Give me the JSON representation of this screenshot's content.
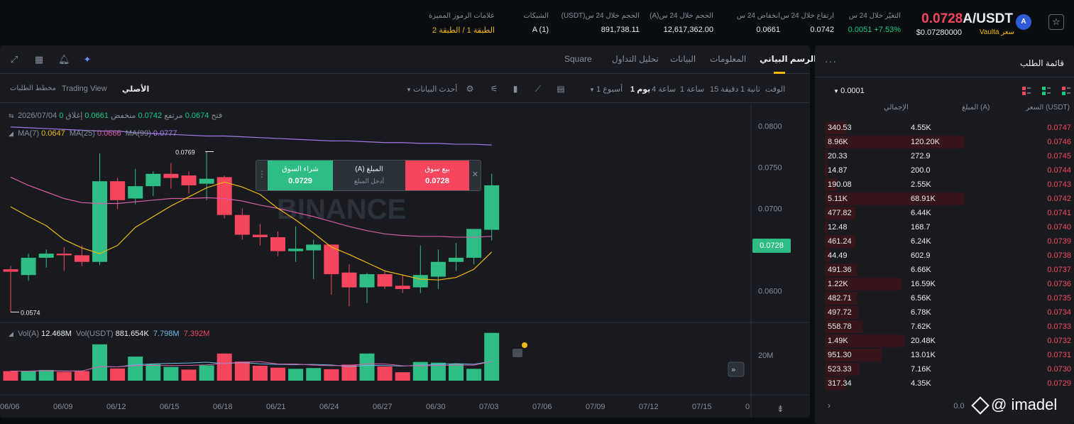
{
  "header": {
    "pair": "A/USDT",
    "last_price": "0.0728",
    "vault_label": "سعر Vaulta",
    "vault_price": "$0.07280000",
    "stats": [
      {
        "label": "التغيّر خلال 24 س",
        "value": "0.0051 +7.53%",
        "tone": "green"
      },
      {
        "label": "ارتفاع خلال 24 س",
        "value": "0.0742",
        "tone": "white"
      },
      {
        "label": "انخفاض 24 س",
        "value": "0.0661",
        "tone": "white"
      },
      {
        "label": "الحجم خلال 24 س(A)",
        "value": "12,617,362.00",
        "tone": "white"
      },
      {
        "label": "الحجم خلال 24 س(USDT)",
        "value": "891,738.11",
        "tone": "white"
      },
      {
        "label": "الشبكات",
        "value": "A (1)",
        "tone": "white"
      },
      {
        "label": "علامات الرموز المميزة",
        "value": "الطبقة 1 / الطبقة 2",
        "tone": "yellow"
      }
    ]
  },
  "chart_tabs": {
    "items": [
      "الرسم البياني",
      "المعلومات",
      "البيانات",
      "تحليل التداول",
      "Square"
    ],
    "active": 0
  },
  "toolbar": {
    "views": [
      "الأصلي",
      "Trading View",
      "مخطط الطلبات"
    ],
    "intervals": [
      "الوقت",
      "1 ثانية",
      "15 دقيقة",
      "1 ساعة",
      "4 ساعة",
      "1 يوم",
      "1 أسبوع"
    ],
    "active_interval": "1 يوم",
    "latest_data": "أحدث البيانات"
  },
  "ohlc": {
    "date": "2026/07/04",
    "open_label": "فتح",
    "open": "0.0674",
    "high_label": "مرتفع",
    "high": "0.0742",
    "low_label": "منخفض",
    "low": "0.0661",
    "close_label": "إغلاق",
    "close": "0"
  },
  "ma": {
    "ma7_label": "MA(7)",
    "ma7": "0.0647",
    "ma25_label": "MA(25)",
    "ma25": "0.0666",
    "ma99_label": "MA(99)",
    "ma99": "0.0777"
  },
  "volume": {
    "label": "Vol(A)",
    "vol_a": "12.468M",
    "usdt_label": "Vol(USDT)",
    "vol_usdt": "881.654K",
    "ma1": "7.798M",
    "ma2": "7.392M"
  },
  "trade_box": {
    "buy_label": "شراء السوق",
    "buy_price": "0.0729",
    "amount_label": "المبلغ (A)",
    "amount_placeholder": "أدخل المبلغ",
    "sell_label": "بيع سوق",
    "sell_price": "0.0728"
  },
  "chart_data": {
    "type": "candlestick",
    "price_ticks": [
      "0.0800",
      "0.0750",
      "0.0700",
      "0.0650",
      "0.0600"
    ],
    "volume_ticks": [
      "20M"
    ],
    "x_ticks": [
      "06/06",
      "06/09",
      "06/12",
      "06/15",
      "06/18",
      "06/21",
      "06/24",
      "06/27",
      "06/30",
      "07/03",
      "07/06",
      "07/09",
      "07/12",
      "07/15",
      "0"
    ],
    "ylim": [
      0.057,
      0.081
    ],
    "current_price": "0.0728",
    "annotations": {
      "max": "0.0769",
      "min": "0.0574"
    },
    "candles": [
      {
        "o": 0.0626,
        "h": 0.063,
        "l": 0.0574,
        "c": 0.0623
      },
      {
        "o": 0.0619,
        "h": 0.0645,
        "l": 0.0612,
        "c": 0.064
      },
      {
        "o": 0.064,
        "h": 0.065,
        "l": 0.0628,
        "c": 0.0645
      },
      {
        "o": 0.0645,
        "h": 0.0653,
        "l": 0.0624,
        "c": 0.0643
      },
      {
        "o": 0.0643,
        "h": 0.0655,
        "l": 0.063,
        "c": 0.0635
      },
      {
        "o": 0.0635,
        "h": 0.0767,
        "l": 0.0631,
        "c": 0.0733
      },
      {
        "o": 0.0733,
        "h": 0.0737,
        "l": 0.0699,
        "c": 0.071
      },
      {
        "o": 0.0712,
        "h": 0.0748,
        "l": 0.0705,
        "c": 0.0727
      },
      {
        "o": 0.0727,
        "h": 0.0745,
        "l": 0.0715,
        "c": 0.0742
      },
      {
        "o": 0.0742,
        "h": 0.0755,
        "l": 0.0724,
        "c": 0.0737
      },
      {
        "o": 0.074,
        "h": 0.0745,
        "l": 0.0718,
        "c": 0.0728
      },
      {
        "o": 0.073,
        "h": 0.0769,
        "l": 0.071,
        "c": 0.0736
      },
      {
        "o": 0.0738,
        "h": 0.074,
        "l": 0.0688,
        "c": 0.0692
      },
      {
        "o": 0.0692,
        "h": 0.07,
        "l": 0.0662,
        "c": 0.0668
      },
      {
        "o": 0.0668,
        "h": 0.0681,
        "l": 0.0655,
        "c": 0.0665
      },
      {
        "o": 0.0665,
        "h": 0.0672,
        "l": 0.0642,
        "c": 0.0648
      },
      {
        "o": 0.0648,
        "h": 0.0678,
        "l": 0.0635,
        "c": 0.0651
      },
      {
        "o": 0.0649,
        "h": 0.0662,
        "l": 0.0614,
        "c": 0.0656
      },
      {
        "o": 0.0656,
        "h": 0.0652,
        "l": 0.0595,
        "c": 0.062
      },
      {
        "o": 0.0622,
        "h": 0.0632,
        "l": 0.0581,
        "c": 0.0604
      },
      {
        "o": 0.0604,
        "h": 0.0622,
        "l": 0.0585,
        "c": 0.062
      },
      {
        "o": 0.062,
        "h": 0.0625,
        "l": 0.0602,
        "c": 0.0605
      },
      {
        "o": 0.0606,
        "h": 0.062,
        "l": 0.0597,
        "c": 0.0602
      },
      {
        "o": 0.0604,
        "h": 0.0655,
        "l": 0.0597,
        "c": 0.0619
      },
      {
        "o": 0.0617,
        "h": 0.065,
        "l": 0.0602,
        "c": 0.0635
      },
      {
        "o": 0.0635,
        "h": 0.0658,
        "l": 0.0624,
        "c": 0.064
      },
      {
        "o": 0.064,
        "h": 0.0675,
        "l": 0.0632,
        "c": 0.0675
      },
      {
        "o": 0.0674,
        "h": 0.0742,
        "l": 0.0661,
        "c": 0.0728
      }
    ],
    "volume_values": [
      2.5,
      2.5,
      2.8,
      2.3,
      2.5,
      9.5,
      3.2,
      6.3,
      4.3,
      3.6,
      2.9,
      4.0,
      7.1,
      5.0,
      3.9,
      3.4,
      3.1,
      3.3,
      3.0,
      4.2,
      7.1,
      3.7,
      2.2,
      4.9,
      4.7,
      4.4,
      3.1,
      12.5
    ],
    "volume_colors": [
      "r",
      "g",
      "g",
      "r",
      "r",
      "g",
      "r",
      "g",
      "g",
      "g",
      "r",
      "g",
      "r",
      "r",
      "r",
      "r",
      "g",
      "g",
      "r",
      "r",
      "g",
      "r",
      "r",
      "g",
      "g",
      "g",
      "g",
      "g"
    ],
    "ma7": [
      0.0702,
      0.069,
      0.0679,
      0.0662,
      0.0652,
      0.0645,
      0.0655,
      0.0677,
      0.069,
      0.0703,
      0.0714,
      0.0725,
      0.0732,
      0.0726,
      0.0717,
      0.07,
      0.0686,
      0.067,
      0.0653,
      0.0644,
      0.0634,
      0.0624,
      0.0619,
      0.0614,
      0.0613,
      0.0616,
      0.0626,
      0.0647
    ],
    "ma25": [
      0.0738,
      0.0728,
      0.072,
      0.0712,
      0.0707,
      0.0706,
      0.0706,
      0.0708,
      0.071,
      0.0712,
      0.0712,
      0.0713,
      0.0712,
      0.0709,
      0.0704,
      0.07,
      0.0695,
      0.069,
      0.0684,
      0.0678,
      0.0673,
      0.0669,
      0.0667,
      0.0666,
      0.0666,
      0.0665,
      0.0665,
      0.0666
    ],
    "ma99": [
      0.0799,
      0.0798,
      0.0797,
      0.0796,
      0.0795,
      0.0794,
      0.0794,
      0.0792,
      0.0791,
      0.079,
      0.0789,
      0.0788,
      0.0788,
      0.0787,
      0.0786,
      0.0785,
      0.0784,
      0.0783,
      0.0782,
      0.0782,
      0.0781,
      0.078,
      0.078,
      0.0779,
      0.0779,
      0.0778,
      0.0778,
      0.0777
    ],
    "colors": {
      "up": "#2ebd85",
      "down": "#f6465d",
      "ma7": "#f0b90b",
      "ma25": "#d85ba7",
      "ma99": "#a57ae8"
    }
  },
  "order_book": {
    "title": "قائمة الطلب",
    "tick": "0.0001",
    "headers": {
      "price": "السعر (USDT)",
      "amount": "المبلغ (A)",
      "total": "الإجمالي"
    },
    "rows": [
      {
        "price": "0.0747",
        "amount": "4.55K",
        "total": "340.53",
        "depth": 0.16
      },
      {
        "price": "0.0746",
        "amount": "120.20K",
        "total": "8.96K",
        "depth": 1.0
      },
      {
        "price": "0.0745",
        "amount": "272.9",
        "total": "20.33",
        "depth": 0.02
      },
      {
        "price": "0.0744",
        "amount": "200.0",
        "total": "14.87",
        "depth": 0.02
      },
      {
        "price": "0.0743",
        "amount": "2.55K",
        "total": "190.08",
        "depth": 0.09
      },
      {
        "price": "0.0742",
        "amount": "68.91K",
        "total": "5.11K",
        "depth": 1.0
      },
      {
        "price": "0.0741",
        "amount": "6.44K",
        "total": "477.82",
        "depth": 0.22
      },
      {
        "price": "0.0740",
        "amount": "168.7",
        "total": "12.48",
        "depth": 0.02
      },
      {
        "price": "0.0739",
        "amount": "6.24K",
        "total": "461.24",
        "depth": 0.22
      },
      {
        "price": "0.0738",
        "amount": "602.9",
        "total": "44.49",
        "depth": 0.04
      },
      {
        "price": "0.0737",
        "amount": "6.66K",
        "total": "491.36",
        "depth": 0.23
      },
      {
        "price": "0.0736",
        "amount": "16.59K",
        "total": "1.22K",
        "depth": 0.55
      },
      {
        "price": "0.0735",
        "amount": "6.56K",
        "total": "482.71",
        "depth": 0.23
      },
      {
        "price": "0.0734",
        "amount": "6.78K",
        "total": "497.72",
        "depth": 0.24
      },
      {
        "price": "0.0733",
        "amount": "7.62K",
        "total": "558.78",
        "depth": 0.27
      },
      {
        "price": "0.0732",
        "amount": "20.48K",
        "total": "1.49K",
        "depth": 0.57
      },
      {
        "price": "0.0731",
        "amount": "13.01K",
        "total": "951.30",
        "depth": 0.41
      },
      {
        "price": "0.0730",
        "amount": "7.16K",
        "total": "523.33",
        "depth": 0.25
      },
      {
        "price": "0.0729",
        "amount": "4.35K",
        "total": "317.34",
        "depth": 0.15
      }
    ],
    "footer": "0.0"
  },
  "watermark": "@ imadel"
}
